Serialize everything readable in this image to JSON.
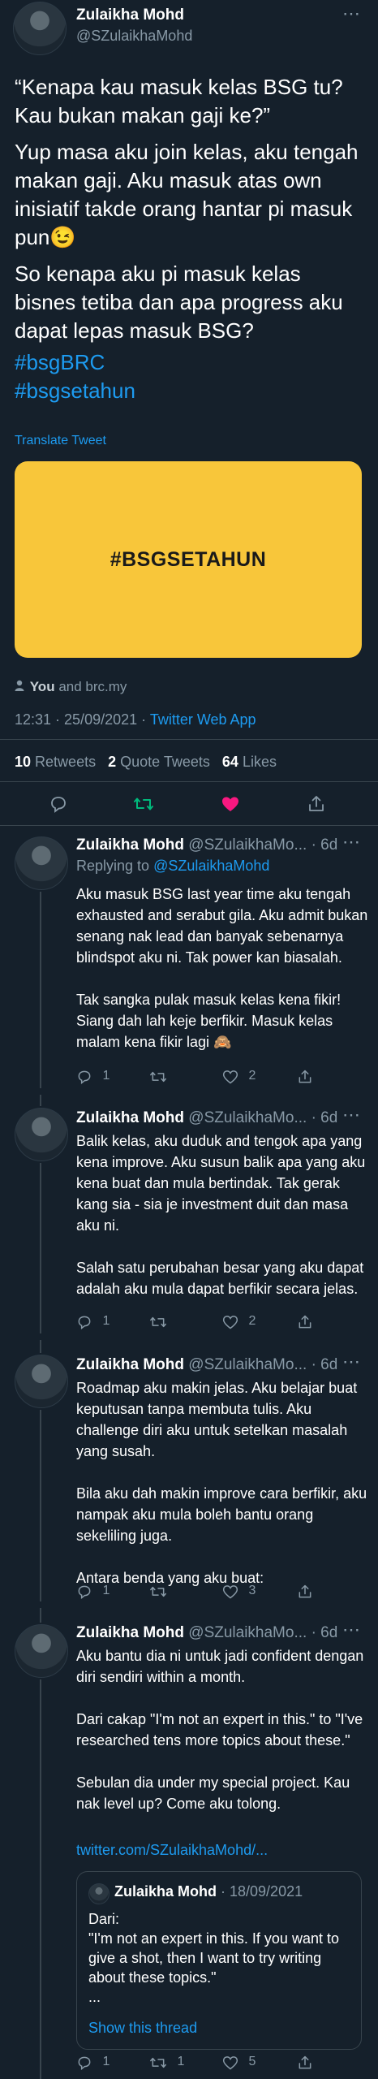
{
  "main_tweet": {
    "name": "Zulaikha Mohd",
    "handle": "@SZulaikhaMohd",
    "paragraphs": [
      "“Kenapa kau masuk kelas BSG tu? Kau bukan makan gaji ke?”",
      "Yup masa aku join kelas, aku tengah makan gaji. Aku masuk atas own inisiatif takde orang hantar pi masuk pun😉",
      "So kenapa aku pi masuk kelas bisnes tetiba dan apa progress aku dapat lepas masuk BSG?"
    ],
    "hashtags": [
      "#bsgBRC",
      "#bsgsetahun"
    ],
    "translate": "Translate Tweet",
    "media_text": "#BSGSETAHUN",
    "media_color": "#f8c63a",
    "tagged_you": "You",
    "tagged_rest": "and brc.my",
    "time": "12:31 · 25/09/2021",
    "separator": "·",
    "source": "Twitter Web App",
    "retweets": "10",
    "retweets_label": "Retweets",
    "quotes": "2",
    "quotes_label": "Quote Tweets",
    "likes": "64",
    "likes_label": "Likes"
  },
  "replies": [
    {
      "name": "Zulaikha Mohd",
      "handle": "@SZulaikhaMo...",
      "age": "· 6d",
      "replying_prefix": "Replying to",
      "replying_handle": "@SZulaikhaMohd",
      "text": "Aku masuk BSG last year time aku tengah exhausted and serabut gila. Aku admit bukan senang nak lead dan banyak sebenarnya blindspot aku ni. Tak power kan biasalah.\n\nTak sangka pulak masuk kelas kena fikir! Siang dah lah keje berfikir. Masuk kelas malam kena fikir lagi 🙈",
      "replies": "1",
      "retweets": "",
      "likes": "2"
    },
    {
      "name": "Zulaikha Mohd",
      "handle": "@SZulaikhaMo...",
      "age": "· 6d",
      "text": "Balik kelas, aku duduk and tengok apa yang kena improve. Aku susun balik apa yang aku kena buat dan mula bertindak. Tak gerak kang sia - sia je investment duit dan masa aku ni.\n\nSalah satu perubahan besar yang aku dapat adalah aku mula dapat berfikir secara jelas.",
      "replies": "1",
      "retweets": "",
      "likes": "2"
    },
    {
      "name": "Zulaikha Mohd",
      "handle": "@SZulaikhaMo...",
      "age": "· 6d",
      "text": "Roadmap aku makin jelas. Aku belajar buat keputusan tanpa membuta tulis. Aku challenge diri aku untuk setelkan masalah yang susah.\n\nBila aku dah makin improve cara berfikir, aku nampak aku mula boleh bantu orang sekeliling juga.\n\nAntara benda yang aku buat:",
      "replies": "1",
      "retweets": "",
      "likes": "3"
    },
    {
      "name": "Zulaikha Mohd",
      "handle": "@SZulaikhaMo...",
      "age": "· 6d",
      "text": "Aku bantu dia ni untuk jadi confident dengan diri sendiri within a month.\n\nDari cakap \"I'm not an expert in this.\" to \"I've researched tens more topics about these.\"\n\nSebulan dia under my special project. Kau nak level up? Come aku tolong.",
      "link": "twitter.com/SZulaikhaMohd/...",
      "quote": {
        "name": "Zulaikha Mohd",
        "date": "· 18/09/2021",
        "text": "Dari:\n\"I'm not an expert in this. If you want to give a shot, then I want to try writing about these topics.\"\n...",
        "show": "Show this thread"
      },
      "replies": "1",
      "retweets": "1",
      "likes": "5"
    }
  ],
  "icons": {
    "more": "⋯",
    "reply": "reply-icon",
    "retweet": "retweet-icon",
    "like": "heart-icon",
    "share": "share-icon",
    "person": "person-icon"
  },
  "colors": {
    "background": "#15202b",
    "accent": "#1d9bf0",
    "retweet_active": "#00ba7c",
    "like_active": "#f91880",
    "muted": "#8899a6"
  }
}
